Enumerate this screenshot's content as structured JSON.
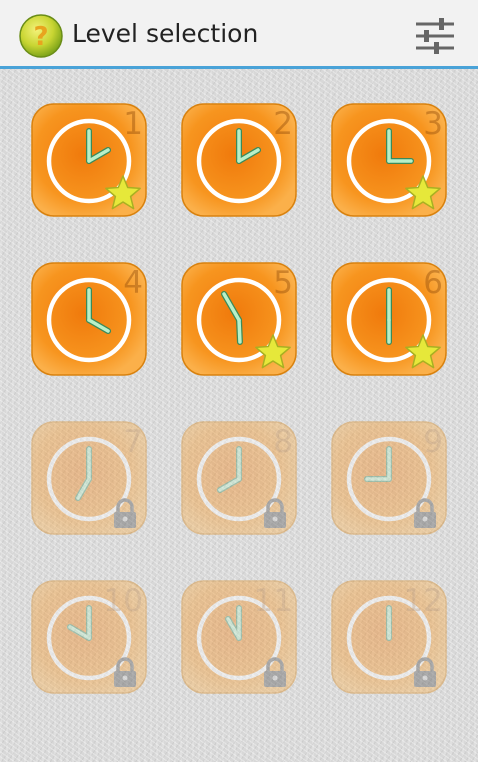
{
  "header": {
    "title": "Level selection",
    "app_icon": "question-mark-icon",
    "settings_icon": "sliders-icon"
  },
  "colors": {
    "accent": "#4aa3d8",
    "tile": "#f7941d",
    "hand": "#b8f0c8",
    "star": "#e6e83a"
  },
  "levels": [
    {
      "number": "1",
      "locked": false,
      "star": true,
      "hour": 2,
      "minute": 0
    },
    {
      "number": "2",
      "locked": false,
      "star": false,
      "hour": 2,
      "minute": 0
    },
    {
      "number": "3",
      "locked": false,
      "star": true,
      "hour": 3,
      "minute": 0
    },
    {
      "number": "4",
      "locked": false,
      "star": false,
      "hour": 4,
      "minute": 0
    },
    {
      "number": "5",
      "locked": false,
      "star": true,
      "hour": 5,
      "minute": 55
    },
    {
      "number": "6",
      "locked": false,
      "star": true,
      "hour": 6,
      "minute": 0
    },
    {
      "number": "7",
      "locked": true,
      "star": false,
      "hour": 7,
      "minute": 0
    },
    {
      "number": "8",
      "locked": true,
      "star": false,
      "hour": 8,
      "minute": 0
    },
    {
      "number": "9",
      "locked": true,
      "star": false,
      "hour": 9,
      "minute": 0
    },
    {
      "number": "10",
      "locked": true,
      "star": false,
      "hour": 10,
      "minute": 0
    },
    {
      "number": "11",
      "locked": true,
      "star": false,
      "hour": 11,
      "minute": 0
    },
    {
      "number": "12",
      "locked": true,
      "star": false,
      "hour": 12,
      "minute": 0
    }
  ]
}
